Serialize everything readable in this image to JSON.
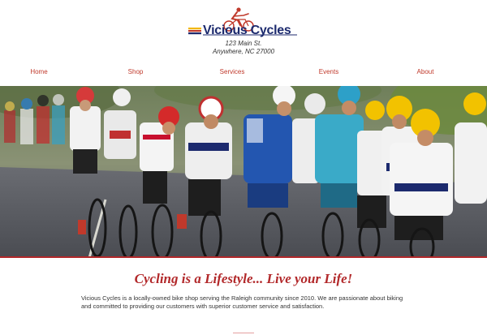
{
  "brand": {
    "name": "Vicious Cycles",
    "address_line1": "123 Main St.",
    "address_line2": "Anywhere, NC 27000",
    "logo_icon": "cyclist-logo-icon"
  },
  "nav": {
    "items": [
      {
        "label": "Home"
      },
      {
        "label": "Shop"
      },
      {
        "label": "Services"
      },
      {
        "label": "Events"
      },
      {
        "label": "About"
      }
    ]
  },
  "hero": {
    "image": "peloton-of-road-cyclists-photo"
  },
  "main": {
    "tagline": "Cycling is a Lifestyle... Live your Life!",
    "intro": "Vicious Cycles is a locally-owned bike shop serving the Raleigh community since 2010. We are passionate about biking and committed to providing our customers with superior customer service and satisfaction."
  },
  "colors": {
    "accent": "#b2282a",
    "brand_navy": "#1c2a6e",
    "logo_yellow": "#f2b705"
  }
}
